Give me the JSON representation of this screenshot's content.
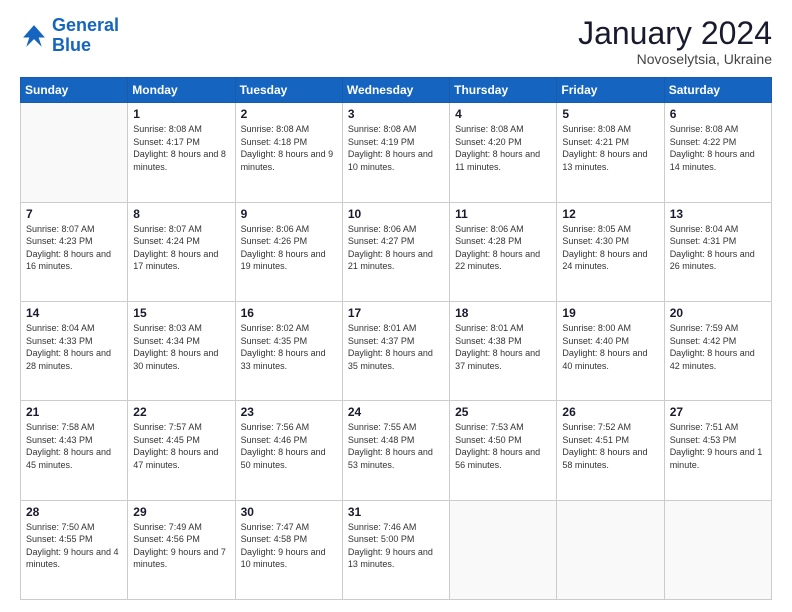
{
  "logo": {
    "line1": "General",
    "line2": "Blue"
  },
  "title": "January 2024",
  "subtitle": "Novoselytsia, Ukraine",
  "days_header": [
    "Sunday",
    "Monday",
    "Tuesday",
    "Wednesday",
    "Thursday",
    "Friday",
    "Saturday"
  ],
  "weeks": [
    [
      {
        "day": "",
        "sunrise": "",
        "sunset": "",
        "daylight": ""
      },
      {
        "day": "1",
        "sunrise": "Sunrise: 8:08 AM",
        "sunset": "Sunset: 4:17 PM",
        "daylight": "Daylight: 8 hours and 8 minutes."
      },
      {
        "day": "2",
        "sunrise": "Sunrise: 8:08 AM",
        "sunset": "Sunset: 4:18 PM",
        "daylight": "Daylight: 8 hours and 9 minutes."
      },
      {
        "day": "3",
        "sunrise": "Sunrise: 8:08 AM",
        "sunset": "Sunset: 4:19 PM",
        "daylight": "Daylight: 8 hours and 10 minutes."
      },
      {
        "day": "4",
        "sunrise": "Sunrise: 8:08 AM",
        "sunset": "Sunset: 4:20 PM",
        "daylight": "Daylight: 8 hours and 11 minutes."
      },
      {
        "day": "5",
        "sunrise": "Sunrise: 8:08 AM",
        "sunset": "Sunset: 4:21 PM",
        "daylight": "Daylight: 8 hours and 13 minutes."
      },
      {
        "day": "6",
        "sunrise": "Sunrise: 8:08 AM",
        "sunset": "Sunset: 4:22 PM",
        "daylight": "Daylight: 8 hours and 14 minutes."
      }
    ],
    [
      {
        "day": "7",
        "sunrise": "Sunrise: 8:07 AM",
        "sunset": "Sunset: 4:23 PM",
        "daylight": "Daylight: 8 hours and 16 minutes."
      },
      {
        "day": "8",
        "sunrise": "Sunrise: 8:07 AM",
        "sunset": "Sunset: 4:24 PM",
        "daylight": "Daylight: 8 hours and 17 minutes."
      },
      {
        "day": "9",
        "sunrise": "Sunrise: 8:06 AM",
        "sunset": "Sunset: 4:26 PM",
        "daylight": "Daylight: 8 hours and 19 minutes."
      },
      {
        "day": "10",
        "sunrise": "Sunrise: 8:06 AM",
        "sunset": "Sunset: 4:27 PM",
        "daylight": "Daylight: 8 hours and 21 minutes."
      },
      {
        "day": "11",
        "sunrise": "Sunrise: 8:06 AM",
        "sunset": "Sunset: 4:28 PM",
        "daylight": "Daylight: 8 hours and 22 minutes."
      },
      {
        "day": "12",
        "sunrise": "Sunrise: 8:05 AM",
        "sunset": "Sunset: 4:30 PM",
        "daylight": "Daylight: 8 hours and 24 minutes."
      },
      {
        "day": "13",
        "sunrise": "Sunrise: 8:04 AM",
        "sunset": "Sunset: 4:31 PM",
        "daylight": "Daylight: 8 hours and 26 minutes."
      }
    ],
    [
      {
        "day": "14",
        "sunrise": "Sunrise: 8:04 AM",
        "sunset": "Sunset: 4:33 PM",
        "daylight": "Daylight: 8 hours and 28 minutes."
      },
      {
        "day": "15",
        "sunrise": "Sunrise: 8:03 AM",
        "sunset": "Sunset: 4:34 PM",
        "daylight": "Daylight: 8 hours and 30 minutes."
      },
      {
        "day": "16",
        "sunrise": "Sunrise: 8:02 AM",
        "sunset": "Sunset: 4:35 PM",
        "daylight": "Daylight: 8 hours and 33 minutes."
      },
      {
        "day": "17",
        "sunrise": "Sunrise: 8:01 AM",
        "sunset": "Sunset: 4:37 PM",
        "daylight": "Daylight: 8 hours and 35 minutes."
      },
      {
        "day": "18",
        "sunrise": "Sunrise: 8:01 AM",
        "sunset": "Sunset: 4:38 PM",
        "daylight": "Daylight: 8 hours and 37 minutes."
      },
      {
        "day": "19",
        "sunrise": "Sunrise: 8:00 AM",
        "sunset": "Sunset: 4:40 PM",
        "daylight": "Daylight: 8 hours and 40 minutes."
      },
      {
        "day": "20",
        "sunrise": "Sunrise: 7:59 AM",
        "sunset": "Sunset: 4:42 PM",
        "daylight": "Daylight: 8 hours and 42 minutes."
      }
    ],
    [
      {
        "day": "21",
        "sunrise": "Sunrise: 7:58 AM",
        "sunset": "Sunset: 4:43 PM",
        "daylight": "Daylight: 8 hours and 45 minutes."
      },
      {
        "day": "22",
        "sunrise": "Sunrise: 7:57 AM",
        "sunset": "Sunset: 4:45 PM",
        "daylight": "Daylight: 8 hours and 47 minutes."
      },
      {
        "day": "23",
        "sunrise": "Sunrise: 7:56 AM",
        "sunset": "Sunset: 4:46 PM",
        "daylight": "Daylight: 8 hours and 50 minutes."
      },
      {
        "day": "24",
        "sunrise": "Sunrise: 7:55 AM",
        "sunset": "Sunset: 4:48 PM",
        "daylight": "Daylight: 8 hours and 53 minutes."
      },
      {
        "day": "25",
        "sunrise": "Sunrise: 7:53 AM",
        "sunset": "Sunset: 4:50 PM",
        "daylight": "Daylight: 8 hours and 56 minutes."
      },
      {
        "day": "26",
        "sunrise": "Sunrise: 7:52 AM",
        "sunset": "Sunset: 4:51 PM",
        "daylight": "Daylight: 8 hours and 58 minutes."
      },
      {
        "day": "27",
        "sunrise": "Sunrise: 7:51 AM",
        "sunset": "Sunset: 4:53 PM",
        "daylight": "Daylight: 9 hours and 1 minute."
      }
    ],
    [
      {
        "day": "28",
        "sunrise": "Sunrise: 7:50 AM",
        "sunset": "Sunset: 4:55 PM",
        "daylight": "Daylight: 9 hours and 4 minutes."
      },
      {
        "day": "29",
        "sunrise": "Sunrise: 7:49 AM",
        "sunset": "Sunset: 4:56 PM",
        "daylight": "Daylight: 9 hours and 7 minutes."
      },
      {
        "day": "30",
        "sunrise": "Sunrise: 7:47 AM",
        "sunset": "Sunset: 4:58 PM",
        "daylight": "Daylight: 9 hours and 10 minutes."
      },
      {
        "day": "31",
        "sunrise": "Sunrise: 7:46 AM",
        "sunset": "Sunset: 5:00 PM",
        "daylight": "Daylight: 9 hours and 13 minutes."
      },
      {
        "day": "",
        "sunrise": "",
        "sunset": "",
        "daylight": ""
      },
      {
        "day": "",
        "sunrise": "",
        "sunset": "",
        "daylight": ""
      },
      {
        "day": "",
        "sunrise": "",
        "sunset": "",
        "daylight": ""
      }
    ]
  ]
}
